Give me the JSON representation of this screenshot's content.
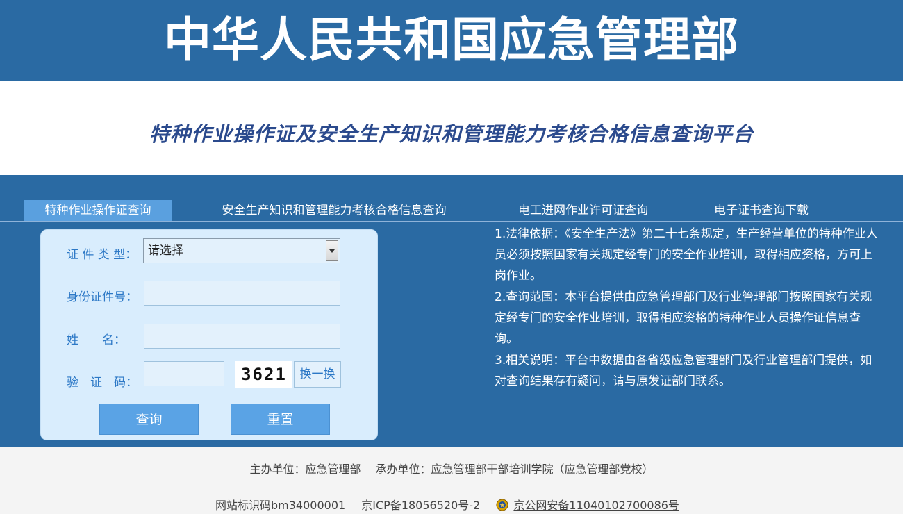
{
  "header": {
    "site_title": "中华人民共和国应急管理部",
    "platform_title": "特种作业操作证及安全生产知识和管理能力考核合格信息查询平台"
  },
  "tabs": [
    {
      "label": "特种作业操作证查询",
      "active": true
    },
    {
      "label": "安全生产知识和管理能力考核合格信息查询",
      "active": false
    },
    {
      "label": "电工进网作业许可证查询",
      "active": false
    },
    {
      "label": "电子证书查询下载",
      "active": false
    }
  ],
  "form": {
    "cert_type_label": "证 件 类 型：",
    "cert_type_value": "请选择",
    "id_label": "身份证件号：",
    "id_value": "",
    "name_label": "姓　　名：",
    "name_value": "",
    "captcha_label": "验　证　码：",
    "captcha_value": "",
    "captcha_image_text": "3621",
    "swap_label": "换一换",
    "query_label": "查询",
    "reset_label": "重置"
  },
  "notes": [
    "1.法律依据：《安全生产法》第二十七条规定，生产经营单位的特种作业人员必须按照国家有关规定经专门的安全作业培训，取得相应资格，方可上岗作业。",
    "2.查询范围：本平台提供由应急管理部门及行业管理部门按照国家有关规定经专门的安全作业培训，取得相应资格的特种作业人员操作证信息查询。",
    "3.相关说明：平台中数据由各省级应急管理部门及行业管理部门提供，如对查询结果存有疑问，请与原发证部门联系。"
  ],
  "footer": {
    "sponsor": "主办单位：应急管理部",
    "organizer": "承办单位：应急管理部干部培训学院（应急管理部党校）",
    "site_code": "网站标识码bm34000001",
    "icp": "京ICP备18056520号-2",
    "police_beian": "京公网安备11040102700086号"
  },
  "colors": {
    "brand_blue": "#2a6aa3",
    "active_tab": "#5aa0df",
    "panel_bg": "#d9edfd",
    "label_blue": "#2c78c6"
  }
}
